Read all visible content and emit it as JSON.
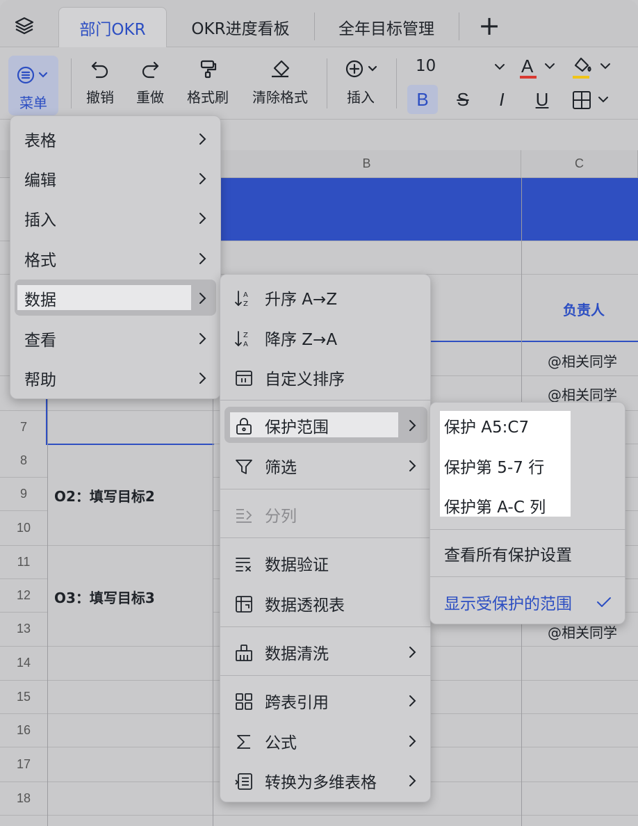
{
  "tabs": [
    {
      "label": "部门OKR",
      "active": true
    },
    {
      "label": "OKR进度看板",
      "active": false
    },
    {
      "label": "全年目标管理",
      "active": false
    }
  ],
  "tab_add": "+",
  "toolbar": {
    "menu": "菜单",
    "undo": "撤销",
    "redo": "重做",
    "format_painter": "格式刷",
    "clear_format": "清除格式",
    "insert": "插入",
    "font_size": "10",
    "bold": "B",
    "strike": "S",
    "italic": "I",
    "underline": "U",
    "font_color_glyph": "A"
  },
  "sheet": {
    "columns": [
      "B",
      "C"
    ],
    "rows": [
      "7",
      "8",
      "9",
      "10",
      "11",
      "12",
      "13",
      "14",
      "15",
      "16",
      "17",
      "18"
    ],
    "owner_header": "负责人",
    "assignee": "@相关同学",
    "goal2": "O2：填写目标2",
    "goal3": "O3：填写目标3"
  },
  "main_menu": {
    "items": [
      {
        "label": "表格"
      },
      {
        "label": "编辑"
      },
      {
        "label": "插入"
      },
      {
        "label": "格式"
      },
      {
        "label": "数据"
      },
      {
        "label": "查看"
      },
      {
        "label": "帮助"
      }
    ]
  },
  "data_menu": {
    "sort_asc": "升序 A→Z",
    "sort_desc": "降序 Z→A",
    "custom_sort": "自定义排序",
    "protect_range": "保护范围",
    "filter": "筛选",
    "split_column": "分列",
    "data_validation": "数据验证",
    "pivot_table": "数据透视表",
    "data_cleaning": "数据清洗",
    "cross_ref": "跨表引用",
    "formula": "公式",
    "convert_multi": "转换为多维表格"
  },
  "protect_menu": {
    "protect_cells": "保护 A5:C7",
    "protect_rows": "保护第 5-7 行",
    "protect_cols": "保护第 A-C 列",
    "view_all": "查看所有保护设置",
    "show_protected": "显示受保护的范围"
  },
  "colors": {
    "accent": "#2c4ec2",
    "band": "#2f4fc1"
  }
}
